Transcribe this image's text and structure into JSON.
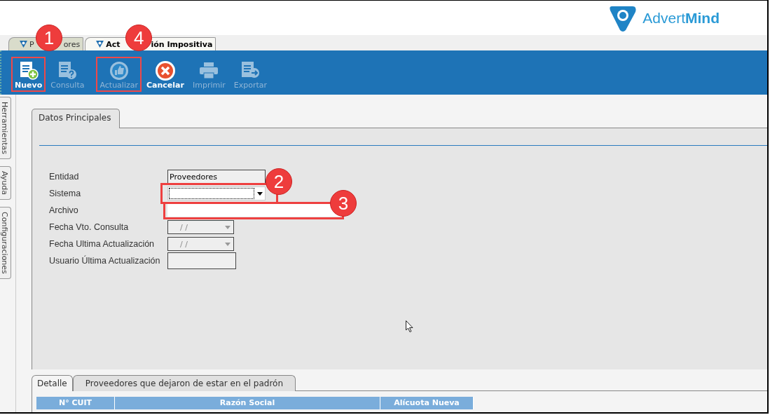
{
  "logo": {
    "text_light": "Advert",
    "text_bold": "Mind"
  },
  "window_tabs": [
    {
      "label_parts": [
        "P",
        "ores"
      ],
      "selected": false,
      "callout": "1"
    },
    {
      "label_parts": [
        "Act",
        "ión Impositiva"
      ],
      "selected": true,
      "callout": "4"
    }
  ],
  "toolbar": [
    {
      "label": "Nuevo",
      "kind": "new",
      "disabled": false,
      "highlighted": true
    },
    {
      "label": "Consulta",
      "kind": "query",
      "disabled": true,
      "highlighted": false
    },
    {
      "label": "Actualizar",
      "kind": "update",
      "disabled": true,
      "highlighted": true
    },
    {
      "label": "Cancelar",
      "kind": "cancel",
      "disabled": false,
      "highlighted": false
    },
    {
      "label": "Imprimir",
      "kind": "print",
      "disabled": true,
      "highlighted": false
    },
    {
      "label": "Exportar",
      "kind": "export",
      "disabled": true,
      "highlighted": false
    }
  ],
  "side_tabs": [
    "Herramientas",
    "Ayuda",
    "Configuraciones"
  ],
  "form_tab": {
    "label": "Datos Principales",
    "selected": true
  },
  "fields": [
    {
      "label": "Entidad",
      "kind": "readonly",
      "value": "Proveedores"
    },
    {
      "label": "Sistema",
      "kind": "dropdown",
      "callout": "2"
    },
    {
      "label": "Archivo",
      "kind": "text",
      "callout": "3"
    },
    {
      "label": "Fecha Vto. Consulta",
      "kind": "date",
      "placeholder": "/  /"
    },
    {
      "label": "Fecha Ultima Actualización",
      "kind": "date",
      "placeholder": "/  /"
    },
    {
      "label": "Usuario Última Actualización",
      "kind": "readonly"
    }
  ],
  "bottom_tabs": [
    {
      "label": "Detalle",
      "selected": true
    },
    {
      "label": "Proveedores que dejaron de estar en el padrón",
      "selected": false
    }
  ],
  "table": {
    "columns": [
      "N° CUIT",
      "Razón Social",
      "Alícuota Nueva"
    ]
  }
}
